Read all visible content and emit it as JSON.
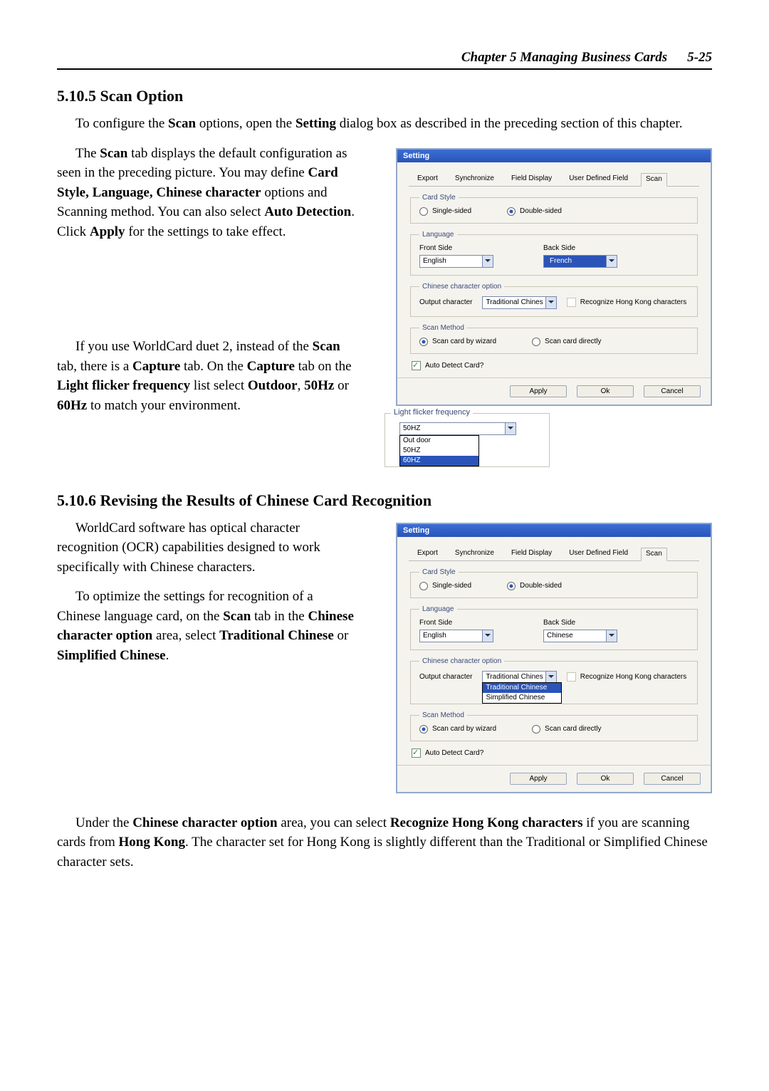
{
  "header": {
    "chapter": "Chapter 5 Managing Business Cards",
    "pagenum": "5-25"
  },
  "s1": {
    "heading": "5.10.5 Scan Option",
    "p1a": "To configure the ",
    "p1b": "Scan",
    "p1c": " options, open the ",
    "p1d": "Setting",
    "p1e": " dialog box as described in the preceding section of this chapter.",
    "p2a": "The ",
    "p2b": "Scan",
    "p2c": " tab displays the default configuration as seen in the preceding picture. You may define ",
    "p2d": "Card Style, Language, Chinese character",
    "p2e": " options and Scanning method. You can also select ",
    "p2f": "Auto Detection",
    "p2g": ". Click ",
    "p2h": "Apply",
    "p2i": " for the settings to take effect.",
    "p3a": "If you use WorldCard duet 2, instead of the ",
    "p3b": "Scan",
    "p3c": " tab, there is a ",
    "p3d": "Capture",
    "p3e": " tab. On the ",
    "p3f": "Capture",
    "p3g": " tab on the ",
    "p3h": "Light flicker frequency",
    "p3i": " list select ",
    "p3j": "Outdoor",
    "p3k": ", ",
    "p3l": "50Hz",
    "p3m": " or ",
    "p3n": "60Hz",
    "p3o": " to match your environment."
  },
  "s2": {
    "heading": "5.10.6 Revising the Results of Chinese Card Recognition",
    "p1": "WorldCard software has optical character recognition (OCR) capabilities designed to work specifically with Chinese characters.",
    "p2a": "To optimize the settings for recognition of a Chinese language card, on the ",
    "p2b": "Scan",
    "p2c": " tab in the ",
    "p2d": "Chinese character option",
    "p2e": " area, select ",
    "p2f": "Traditional Chinese",
    "p2g": " or ",
    "p2h": "Simplified Chinese",
    "p2i": ".",
    "p3a": "Under the ",
    "p3b": "Chinese character option",
    "p3c": " area, you  can select ",
    "p3d": "Recognize Hong Kong characters",
    "p3e": " if you are scanning cards from ",
    "p3f": "Hong Kong",
    "p3g": ". The character set for Hong Kong is slightly different than the Traditional or Simplified Chinese character sets."
  },
  "dlg": {
    "title": "Setting",
    "tabs": {
      "export": "Export",
      "sync": "Synchronize",
      "field": "Field Display",
      "user": "User Defined Field",
      "scan": "Scan"
    },
    "cardstyle": {
      "legend": "Card Style",
      "single": "Single-sided",
      "double": "Double-sided"
    },
    "lang": {
      "legend": "Language",
      "front": "Front Side",
      "back": "Back Side",
      "frontval": "English",
      "backval1": "French",
      "backval2": "Chinese"
    },
    "cco": {
      "legend": "Chinese character option",
      "outlabel": "Output character",
      "outval": "Traditional Chines",
      "recog": "Recognize Hong Kong characters",
      "opt1": "Traditional Chinese",
      "opt2": "Simplified  Chinese"
    },
    "scanm": {
      "legend": "Scan Method",
      "wizard": "Scan card by wizard",
      "direct": "Scan card directly"
    },
    "auto": "Auto Detect Card?",
    "btn": {
      "apply": "Apply",
      "ok": "Ok",
      "cancel": "Cancel"
    }
  },
  "flicker": {
    "legend": "Light flicker frequency",
    "value": "50HZ",
    "opt1": "Out door",
    "opt2": "50HZ",
    "opt3": "60HZ"
  }
}
